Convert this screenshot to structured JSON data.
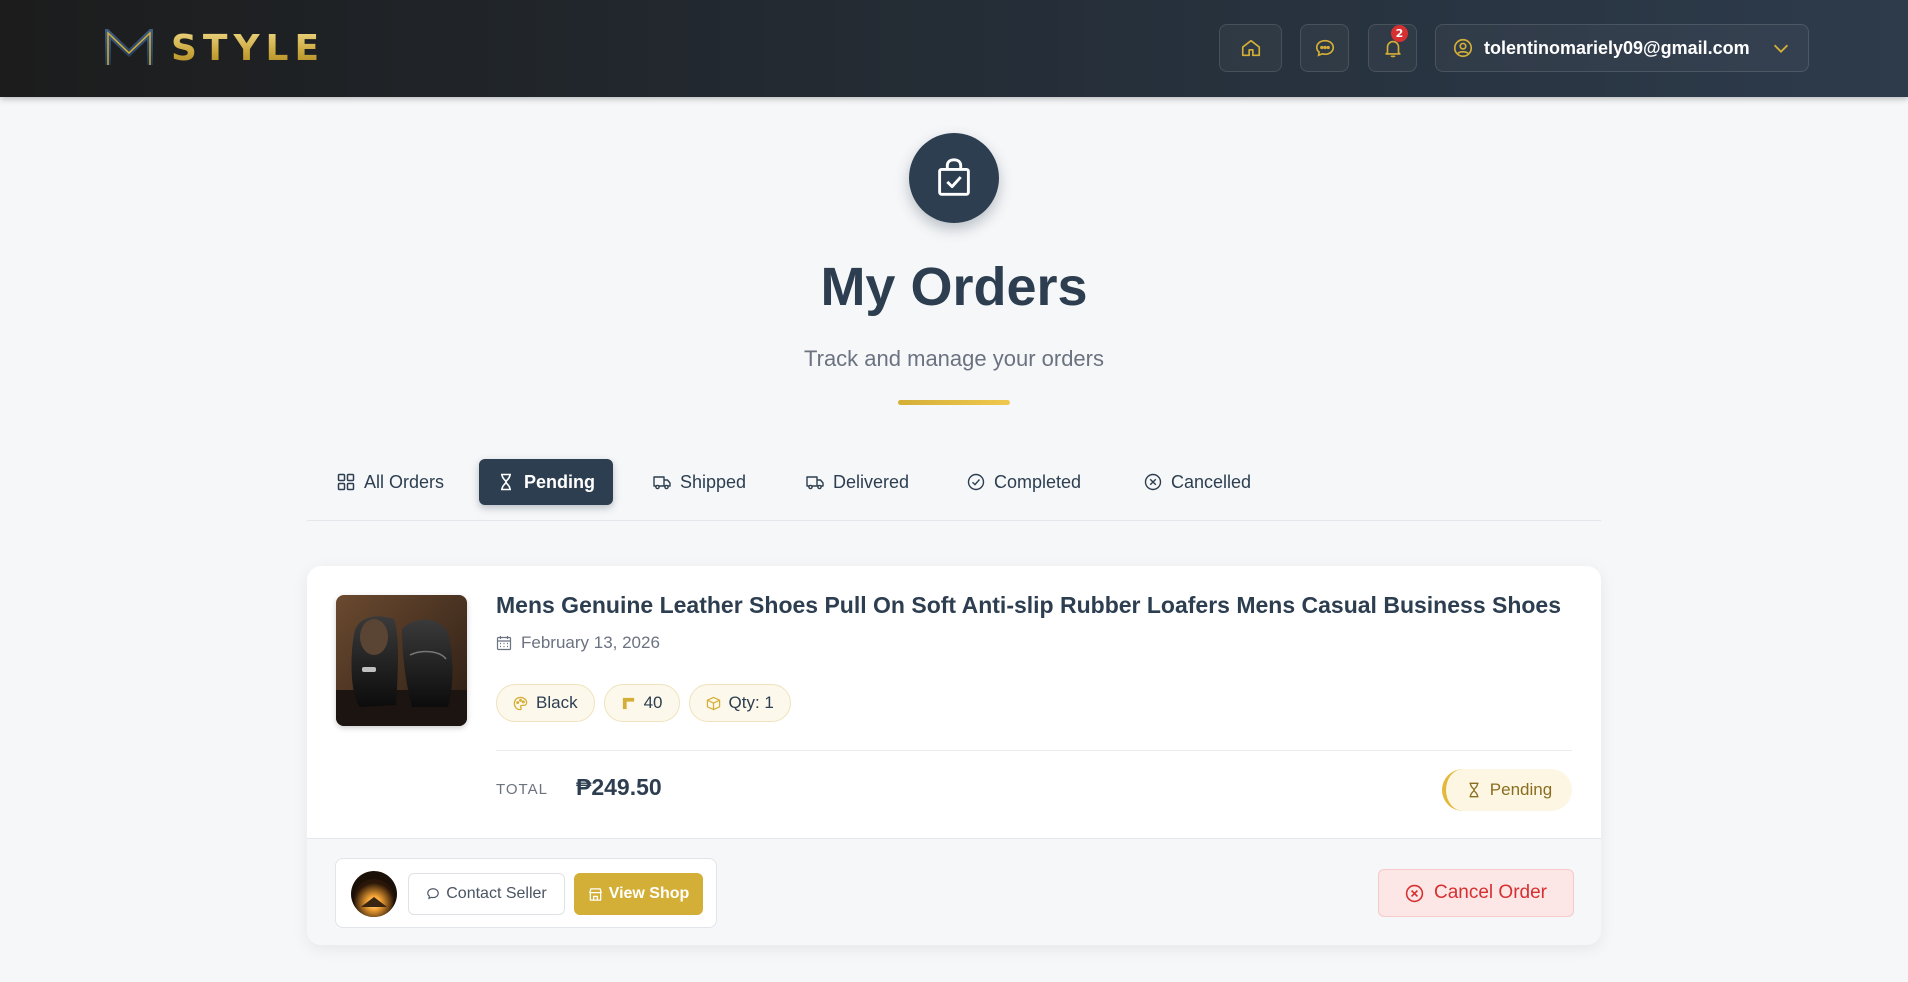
{
  "header": {
    "brand_name": "STYLE",
    "notification_count": "2",
    "user_email": "tolentinomariely09@gmail.com",
    "icons": [
      "home-icon",
      "chat-icon",
      "bell-icon",
      "user-circle-icon",
      "chevron-down-icon"
    ]
  },
  "hero": {
    "title": "My Orders",
    "subtitle": "Track and manage your orders",
    "icon": "shopping-bag-check-icon"
  },
  "tabs": [
    {
      "label": "All Orders",
      "icon": "grid-icon",
      "active": false
    },
    {
      "label": "Pending",
      "icon": "hourglass-icon",
      "active": true
    },
    {
      "label": "Shipped",
      "icon": "truck-icon",
      "active": false
    },
    {
      "label": "Delivered",
      "icon": "truck-icon",
      "active": false
    },
    {
      "label": "Completed",
      "icon": "check-circle-icon",
      "active": false
    },
    {
      "label": "Cancelled",
      "icon": "x-circle-icon",
      "active": false
    }
  ],
  "order": {
    "product_name": "Mens Genuine Leather Shoes Pull On Soft Anti-slip Rubber Loafers Mens Casual Business Shoes",
    "date": "February 13, 2026",
    "color": "Black",
    "size": "40",
    "quantity": "Qty: 1",
    "total_label": "TOTAL",
    "total_value": "₱249.50",
    "status": "Pending",
    "contact_seller_label": "Contact Seller",
    "view_shop_label": "View Shop",
    "cancel_label": "Cancel Order"
  },
  "colors": {
    "primary": "#2c3e50",
    "accent_gold": "#d4af37",
    "danger": "#d63031",
    "background": "#f6f7f9"
  }
}
